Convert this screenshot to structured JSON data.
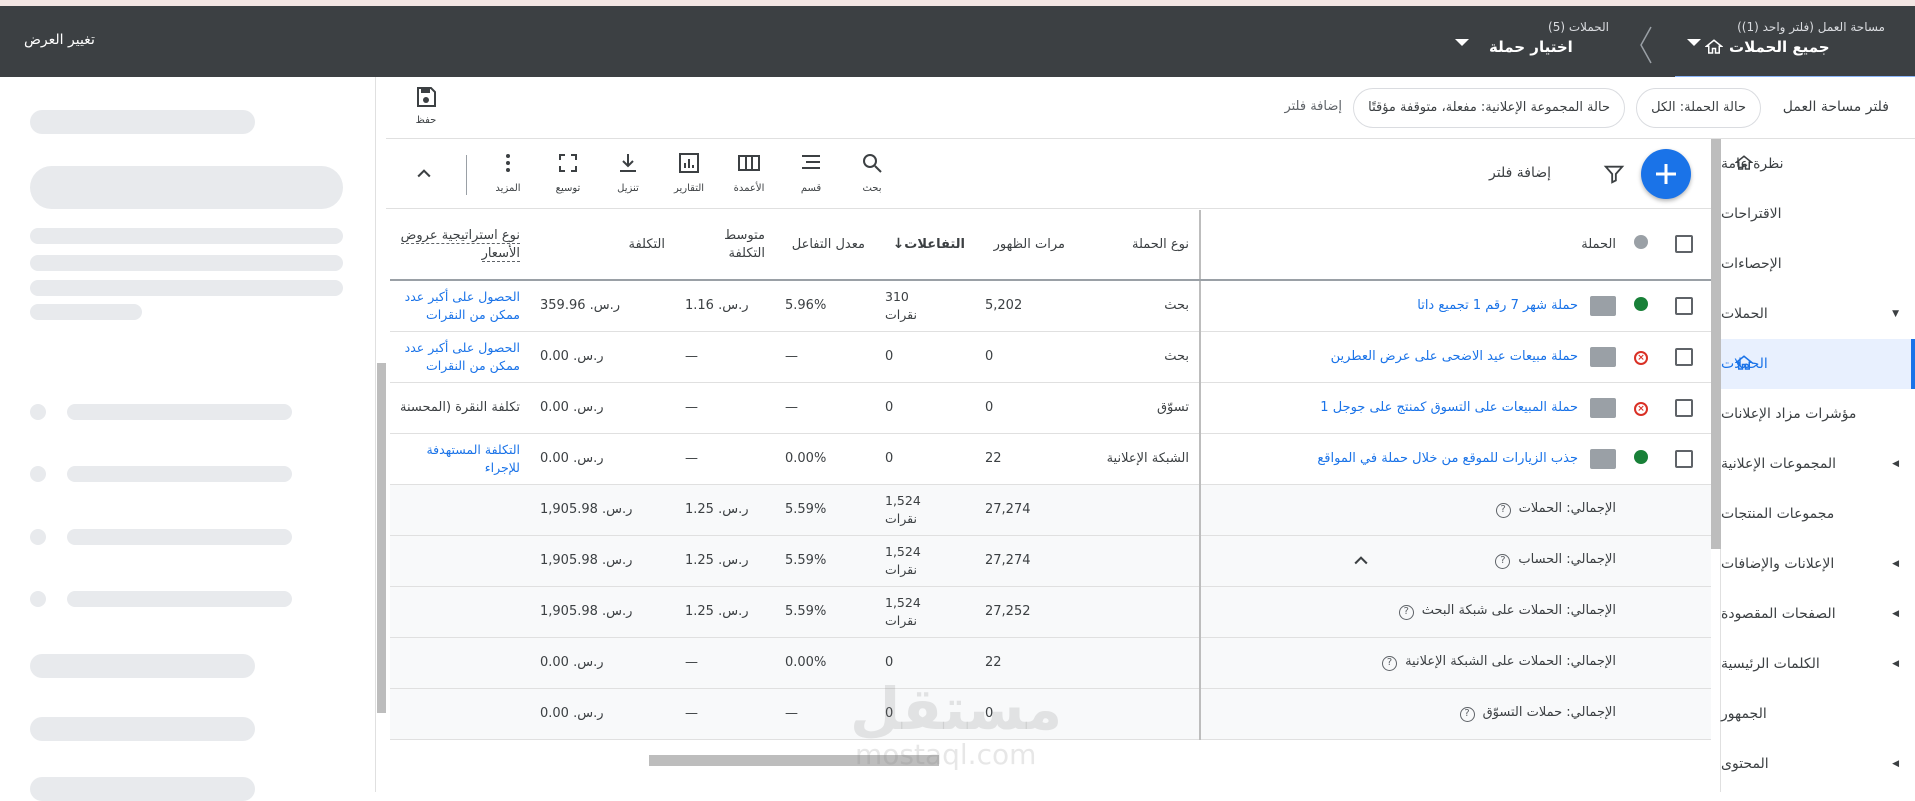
{
  "topbar": {
    "workspace_sub": "مساحة العمل (فلتر واحد (1))",
    "workspace_main": "جميع الحملات",
    "campaigns_sub": "الحملات (5)",
    "campaigns_main": "اختيار حملة",
    "change_view": "تغيير العرض"
  },
  "filterbar": {
    "label": "فلتر مساحة العمل",
    "chip_status": "حالة الحملة: الكل",
    "chip_adgroup": "حالة المجموعة الإعلانية: مفعلة، متوقفة مؤقتًا",
    "add_filter": "إضافة فلتر",
    "save_label": "حفظ"
  },
  "nav": {
    "items": [
      {
        "label": "نظرة عامة"
      },
      {
        "label": "الاقتراحات"
      },
      {
        "label": "الإحصاءات"
      },
      {
        "label": "الحملات"
      },
      {
        "label": "الحملات"
      },
      {
        "label": "مؤشرات مزاد الإعلانات"
      },
      {
        "label": "المجموعات الإعلانية"
      },
      {
        "label": "مجموعات المنتجات"
      },
      {
        "label": "الإعلانات والإضافات"
      },
      {
        "label": "الصفحات المقصودة"
      },
      {
        "label": "الكلمات الرئيسية"
      },
      {
        "label": "الجمهور"
      },
      {
        "label": "المحتوى"
      }
    ]
  },
  "toolbar": {
    "add_filter": "إضافة فلتر",
    "search": "بحث",
    "segment": "قسم",
    "columns": "الأعمدة",
    "reports": "التقارير",
    "download": "تنزيل",
    "expand": "توسيع",
    "more": "المزيد"
  },
  "table": {
    "headers": {
      "campaign": "الحملة",
      "type": "نوع الحملة",
      "impressions": "مرات الظهور",
      "interactions": "التفاعلات",
      "interaction_rate": "معدل التفاعل",
      "avg_cost": "متوسط التكلفة",
      "cost": "التكلفة",
      "bid_strategy": "نوع استراتيجية عروض الأسعار"
    },
    "rows": [
      {
        "name": "حملة شهر 7 رقم 1 تجميع داتا",
        "type": "بحث",
        "impressions": "5,202",
        "interactions": "310",
        "interactions_unit": "نقرات",
        "rate": "5.96%",
        "avg_cost": "ر.س. 1.16",
        "cost": "ر.س. 359.96",
        "bid": "الحصول على أكبر عدد ممكن من النقرات"
      },
      {
        "name": "حملة مبيعات عيد الاضحى على عرض العطرين",
        "type": "بحث",
        "impressions": "0",
        "interactions": "0",
        "interactions_unit": "",
        "rate": "—",
        "avg_cost": "—",
        "cost": "ر.س. 0.00",
        "bid": "الحصول على أكبر عدد ممكن من النقرات"
      },
      {
        "name": "حملة المبيعات على التسوق كمنتج على جوجل 1",
        "type": "تسوّق",
        "impressions": "0",
        "interactions": "0",
        "interactions_unit": "",
        "rate": "—",
        "avg_cost": "—",
        "cost": "ر.س. 0.00",
        "bid": "تكلفة النقرة (المحسنة"
      },
      {
        "name": "جذب الزيارات للموقع من خلال حملة في المواقع",
        "type": "الشبكة الإعلانية",
        "impressions": "22",
        "interactions": "0",
        "interactions_unit": "",
        "rate": "0.00%",
        "avg_cost": "—",
        "cost": "ر.س. 0.00",
        "bid": "التكلفة المستهدفة للإجراء"
      }
    ],
    "totals": [
      {
        "label": "الإجمالي: الحملات",
        "impressions": "27,274",
        "interactions": "1,524",
        "interactions_unit": "نقرات",
        "rate": "5.59%",
        "avg_cost": "ر.س. 1.25",
        "cost": "ر.س. 1,905.98"
      },
      {
        "label": "الإجمالي: الحساب",
        "impressions": "27,274",
        "interactions": "1,524",
        "interactions_unit": "نقرات",
        "rate": "5.59%",
        "avg_cost": "ر.س. 1.25",
        "cost": "ر.س. 1,905.98"
      },
      {
        "label": "الإجمالي: الحملات على شبكة البحث",
        "impressions": "27,252",
        "interactions": "1,524",
        "interactions_unit": "نقرات",
        "rate": "5.59%",
        "avg_cost": "ر.س. 1.25",
        "cost": "ر.س. 1,905.98"
      },
      {
        "label": "الإجمالي: الحملات على الشبكة الإعلانية",
        "impressions": "22",
        "interactions": "0",
        "interactions_unit": "",
        "rate": "0.00%",
        "avg_cost": "—",
        "cost": "ر.س. 0.00"
      },
      {
        "label": "الإجمالي: حملات التسوّق",
        "impressions": "0",
        "interactions": "0",
        "interactions_unit": "",
        "rate": "—",
        "avg_cost": "—",
        "cost": "ر.س. 0.00"
      }
    ]
  },
  "watermark": {
    "arabic": "مستقل",
    "latin": "mostaql.com"
  },
  "colors": {
    "accent": "#1a73e8",
    "topbar": "#3c4043",
    "active_green": "#188038",
    "removed_red": "#d93025"
  }
}
